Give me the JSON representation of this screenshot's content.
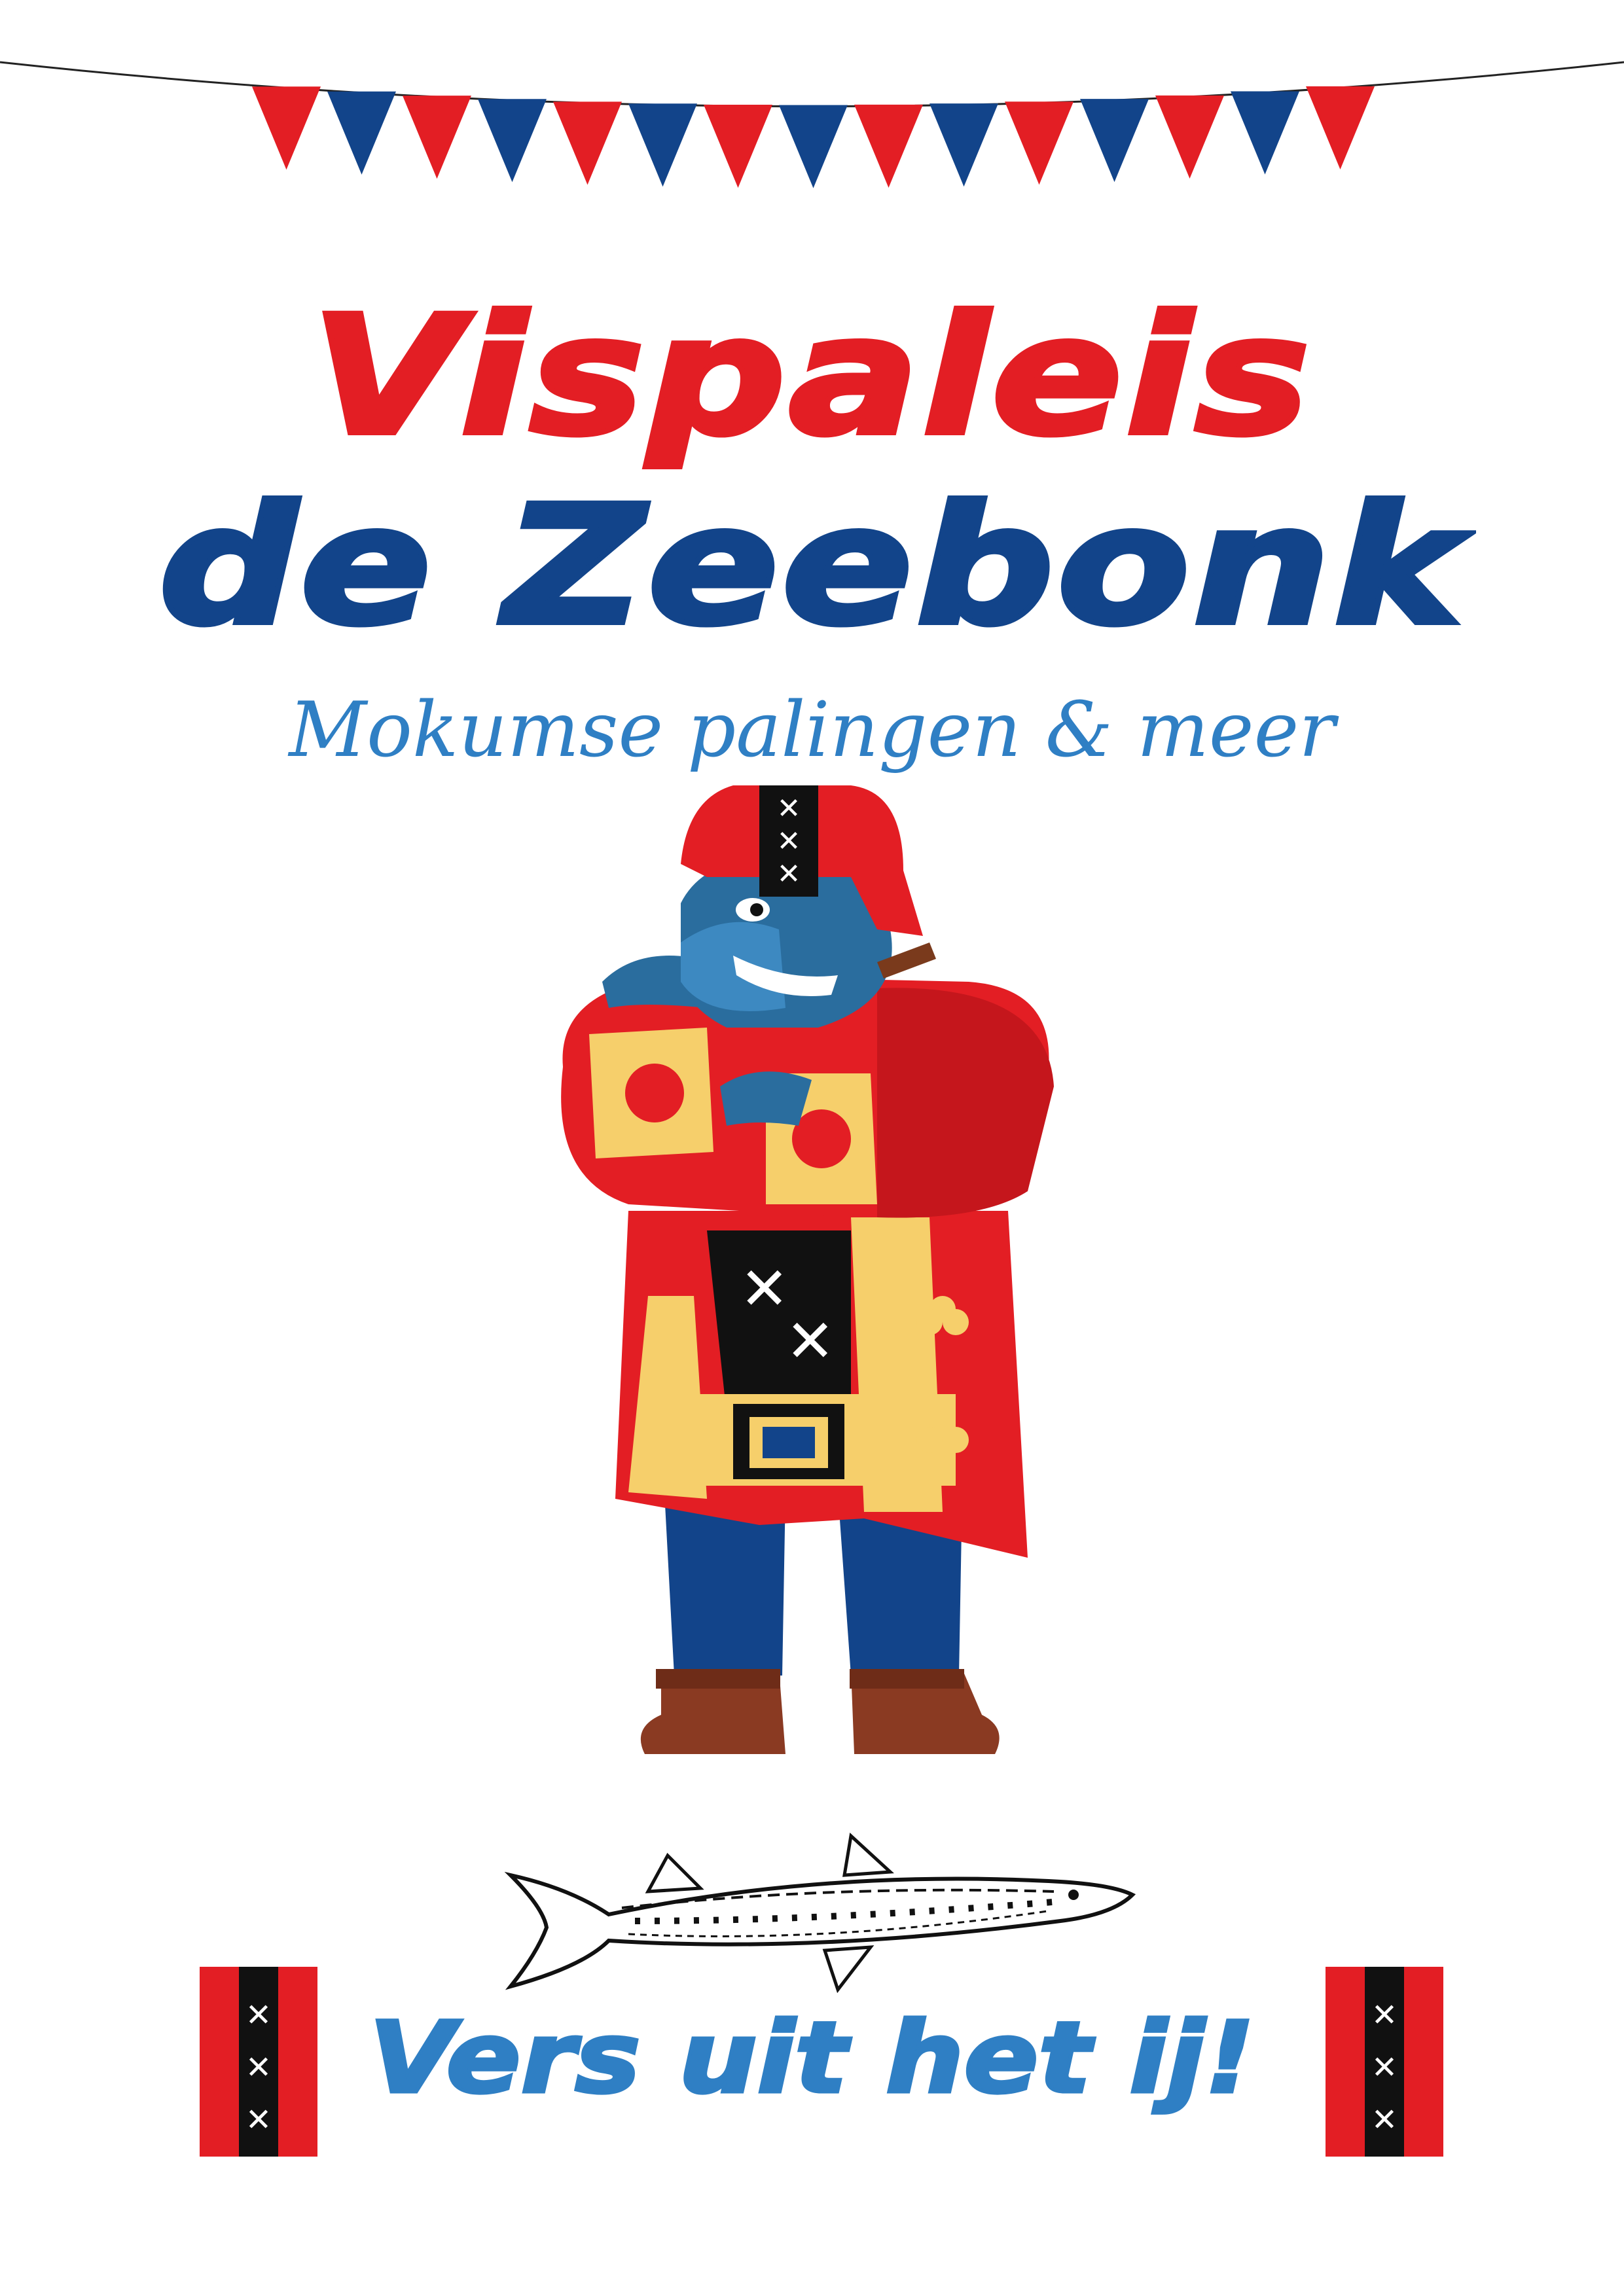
{
  "title": {
    "line1": "Vispaleis",
    "line2": "de Zeebonk"
  },
  "subtitle": "Mokumse palingen & meer",
  "tagline": "Vers uit het ij!",
  "colors": {
    "red": "#e31e24",
    "navy": "#12448a",
    "light_blue": "#2f7fc4",
    "gold": "#f6cf6b",
    "black": "#111111"
  },
  "decorations": {
    "bunting": "red-and-blue-pennant-garland",
    "mascot": "gorilla-in-amsterdam-costume-icon",
    "fish": "barracuda-fish-icon",
    "flags": "amsterdam-xxx-flag-icon"
  }
}
